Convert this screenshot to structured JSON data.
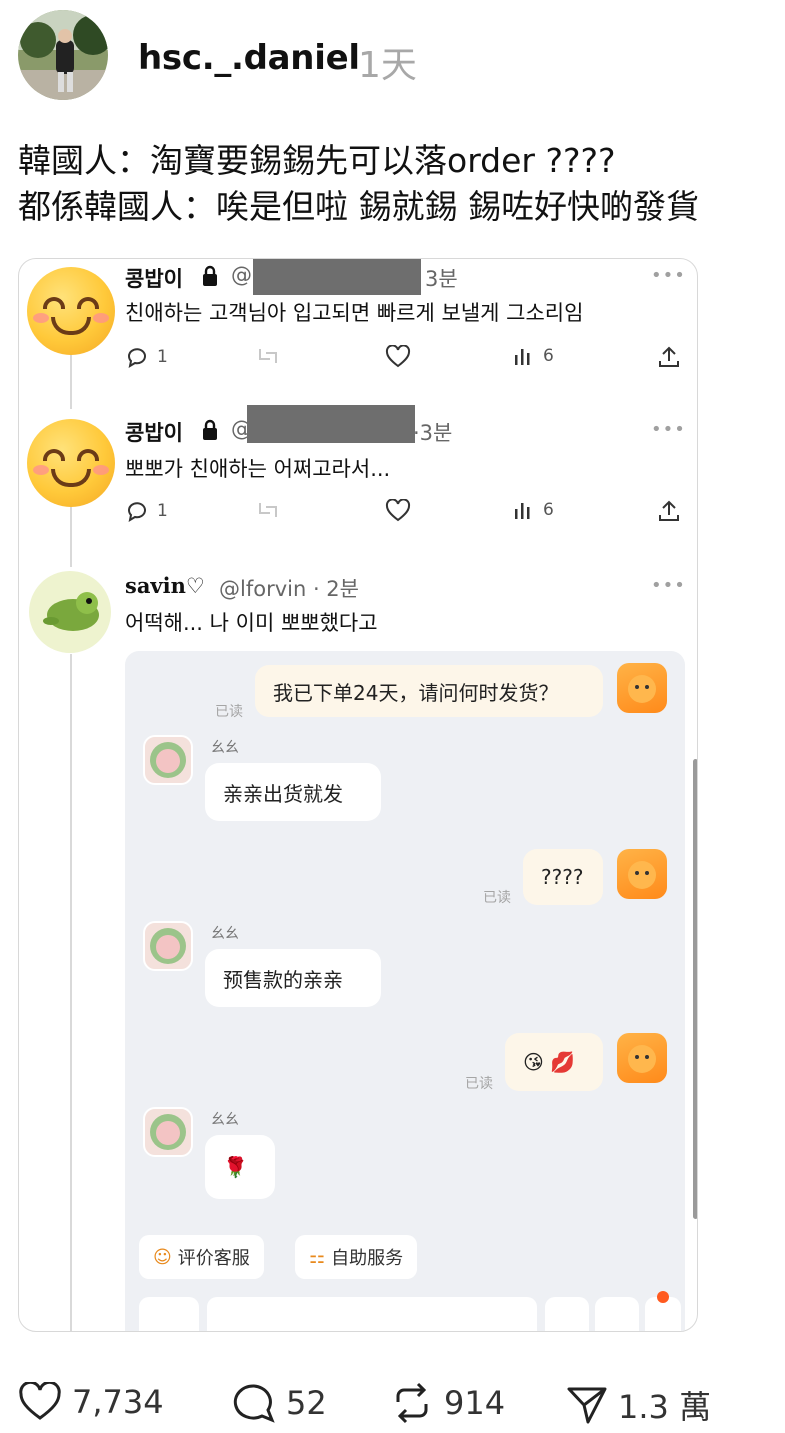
{
  "post": {
    "username": "hsc._.daniel",
    "time": "1天",
    "line1": "韓國人：淘寶要錫錫先可以落order ????",
    "line2": "都係韓國人：唉是但啦 錫就錫 錫咗好快啲發貨"
  },
  "tweets": [
    {
      "name": "콩밥이",
      "handle_prefix": "@",
      "time": "3분",
      "text": "친애하는 고객님아 입고되면 빠르게 보낼게 그소리임",
      "replies": "1",
      "views": "6",
      "more": "•••"
    },
    {
      "name": "콩밥이",
      "handle_prefix": "@",
      "time": "·3분",
      "text": "뽀뽀가 친애하는 어쩌고라서...",
      "replies": "1",
      "views": "6",
      "more": "•••"
    },
    {
      "name": "savin♡",
      "handle": "@lforvin · 2분",
      "text": "어떡해... 나 이미 뽀뽀했다고",
      "more": "•••"
    }
  ],
  "chat": {
    "msg1": "我已下单24天，请问何时发货？",
    "read1": "已读",
    "seller": "幺幺",
    "reply1": "亲亲出货就发",
    "msg2": "????",
    "read2": "已读",
    "seller2": "幺幺",
    "reply2": "预售款的亲亲",
    "msg3": "😘 💋",
    "read3": "已读",
    "seller3": "幺幺",
    "reply3": "🌹",
    "chip1": "评价客服",
    "chip2": "自助服务"
  },
  "actions": {
    "likes": "7,734",
    "comments": "52",
    "reposts": "914",
    "shares": "1.3 萬"
  },
  "icons": {
    "lock": "lock-icon",
    "reply": "reply-icon",
    "retweet": "retweet-icon",
    "like": "heart-icon",
    "views": "views-icon",
    "share": "share-icon"
  }
}
